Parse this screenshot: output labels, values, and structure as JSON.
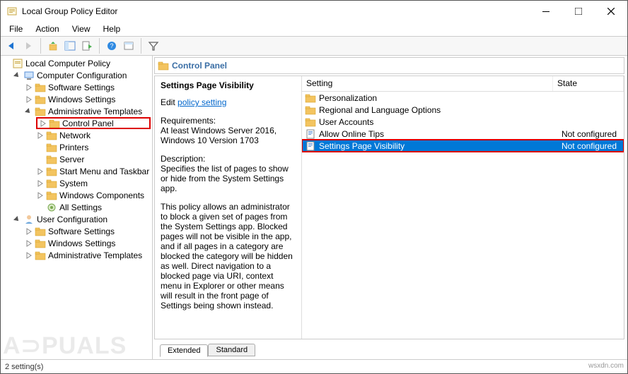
{
  "window": {
    "title": "Local Group Policy Editor"
  },
  "menubar": [
    "File",
    "Action",
    "View",
    "Help"
  ],
  "tree": {
    "root": "Local Computer Policy",
    "cc": {
      "label": "Computer Configuration",
      "children": {
        "ss": "Software Settings",
        "ws": "Windows Settings",
        "at": {
          "label": "Administrative Templates",
          "children": {
            "cp": "Control Panel",
            "network": "Network",
            "printers": "Printers",
            "server": "Server",
            "start": "Start Menu and Taskbar",
            "system": "System",
            "wincomp": "Windows Components",
            "allset": "All Settings"
          }
        }
      }
    },
    "uc": {
      "label": "User Configuration",
      "children": {
        "ss": "Software Settings",
        "ws": "Windows Settings",
        "at": "Administrative Templates"
      }
    }
  },
  "header": {
    "path": "Control Panel"
  },
  "desc": {
    "title": "Settings Page Visibility",
    "editLabel": "Edit",
    "editLink": "policy setting",
    "reqLabel": "Requirements:",
    "reqText": "At least Windows Server 2016, Windows 10 Version 1703",
    "descLabel": "Description:",
    "descText1": "Specifies the list of pages to show or hide from the System Settings app.",
    "descText2": "This policy allows an administrator to block a given set of pages from the System Settings app. Blocked pages will not be visible in the app, and if all pages in a category are blocked the category will be hidden as well. Direct navigation to a blocked page via URI, context menu in Explorer or other means will result in the front page of Settings being shown instead."
  },
  "list": {
    "cols": {
      "setting": "Setting",
      "state": "State"
    },
    "items": [
      {
        "type": "folder",
        "label": "Personalization",
        "state": ""
      },
      {
        "type": "folder",
        "label": "Regional and Language Options",
        "state": ""
      },
      {
        "type": "folder",
        "label": "User Accounts",
        "state": ""
      },
      {
        "type": "setting",
        "label": "Allow Online Tips",
        "state": "Not configured",
        "selected": false
      },
      {
        "type": "setting",
        "label": "Settings Page Visibility",
        "state": "Not configured",
        "selected": true,
        "boxed": true
      }
    ]
  },
  "tabs": {
    "extended": "Extended",
    "standard": "Standard"
  },
  "statusbar": "2 setting(s)",
  "watermark": "A⊃PUALS",
  "credit": "wsxdn.com"
}
